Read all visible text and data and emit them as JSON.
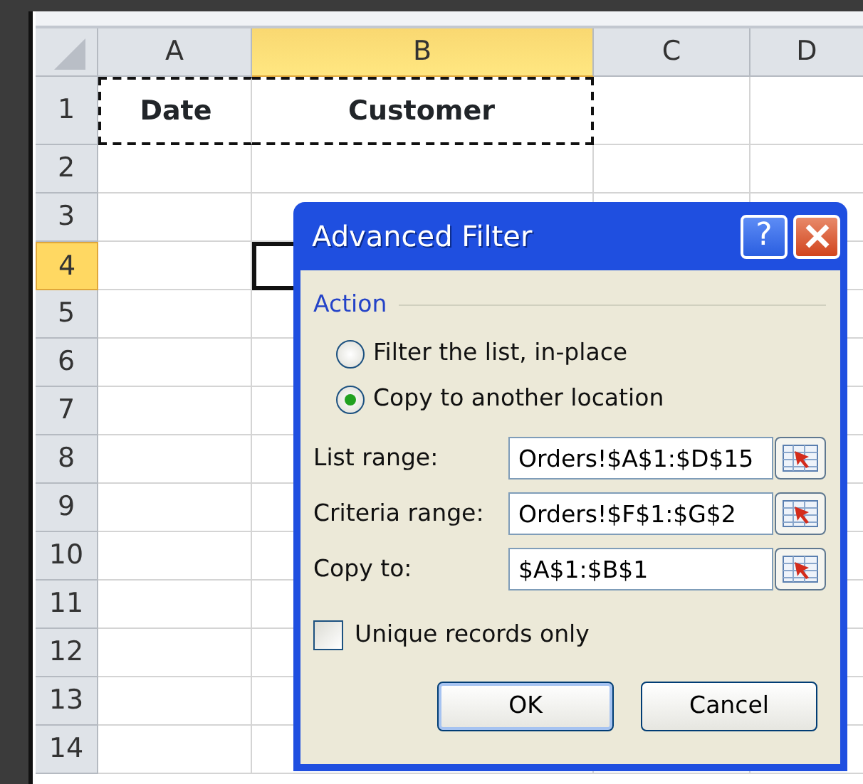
{
  "sheet": {
    "columns": [
      {
        "label": "A",
        "selected": false
      },
      {
        "label": "B",
        "selected": true
      },
      {
        "label": "C",
        "selected": false
      },
      {
        "label": "D",
        "selected": false
      }
    ],
    "rows": [
      {
        "label": "1",
        "selected": false,
        "cells": [
          {
            "text": "Date",
            "marquee": true
          },
          {
            "text": "Customer",
            "marquee": true
          }
        ]
      },
      {
        "label": "2",
        "selected": false
      },
      {
        "label": "3",
        "selected": false
      },
      {
        "label": "4",
        "selected": true,
        "cells": [
          {},
          {
            "active": true
          }
        ]
      },
      {
        "label": "5",
        "selected": false
      },
      {
        "label": "6",
        "selected": false
      },
      {
        "label": "7",
        "selected": false
      },
      {
        "label": "8",
        "selected": false
      },
      {
        "label": "9",
        "selected": false
      },
      {
        "label": "10",
        "selected": false
      },
      {
        "label": "11",
        "selected": false
      },
      {
        "label": "12",
        "selected": false
      },
      {
        "label": "13",
        "selected": false
      },
      {
        "label": "14",
        "selected": false
      }
    ]
  },
  "dialog": {
    "title": "Advanced Filter",
    "help": "?",
    "group": "Action",
    "options": [
      {
        "label": "Filter the list, in-place",
        "selected": false
      },
      {
        "label": "Copy to another location",
        "selected": true
      }
    ],
    "fields": [
      {
        "label": "List range:",
        "value": "Orders!$A$1:$D$15"
      },
      {
        "label": "Criteria range:",
        "value": "Orders!$F$1:$G$2"
      },
      {
        "label": "Copy to:",
        "value": "$A$1:$B$1"
      }
    ],
    "checkbox": {
      "label": "Unique records only",
      "checked": false
    },
    "buttons": [
      {
        "label": "OK",
        "default": true
      },
      {
        "label": "Cancel",
        "default": false
      }
    ]
  }
}
